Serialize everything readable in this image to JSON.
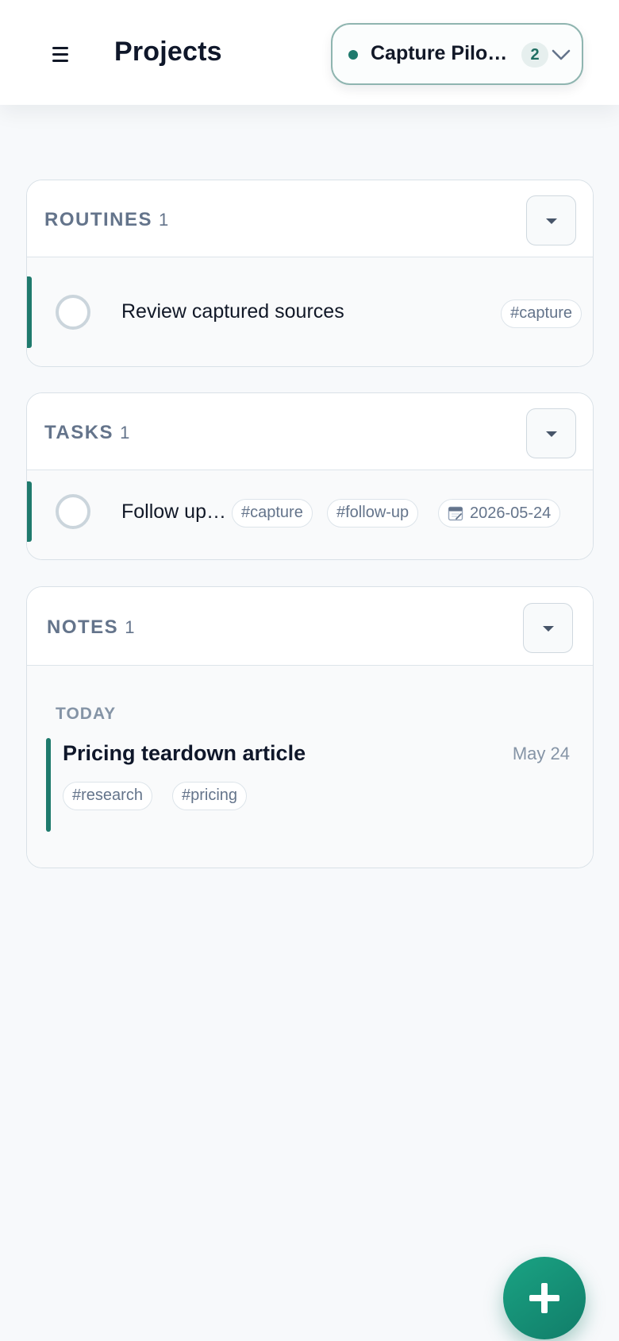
{
  "header": {
    "title": "Projects",
    "menu_icon": "hamburger-menu-icon",
    "project_selector": {
      "name": "Capture Pilot…",
      "count": "2",
      "status_color": "#1f7a6d",
      "chevron_icon": "chevron-down-icon"
    }
  },
  "routines": {
    "label": "ROUTINES",
    "count": "1",
    "items": [
      {
        "title": "Review captured sources",
        "tags": [
          "#capture"
        ]
      }
    ]
  },
  "tasks": {
    "label": "TASKS",
    "count": "1",
    "items": [
      {
        "title": "Follow up…",
        "tags": [
          "#capture",
          "#follow-up"
        ],
        "due_date": "2026-05-24",
        "due_icon": "calendar-icon"
      }
    ]
  },
  "notes": {
    "label": "NOTES",
    "count": "1",
    "group_label": "TODAY",
    "items": [
      {
        "title": "Pricing teardown article",
        "date": "May 24",
        "tags": [
          "#research",
          "#pricing"
        ]
      }
    ]
  },
  "fab": {
    "icon": "plus-icon"
  },
  "colors": {
    "accent": "#1f7a6d",
    "fab": "#159a7d"
  }
}
